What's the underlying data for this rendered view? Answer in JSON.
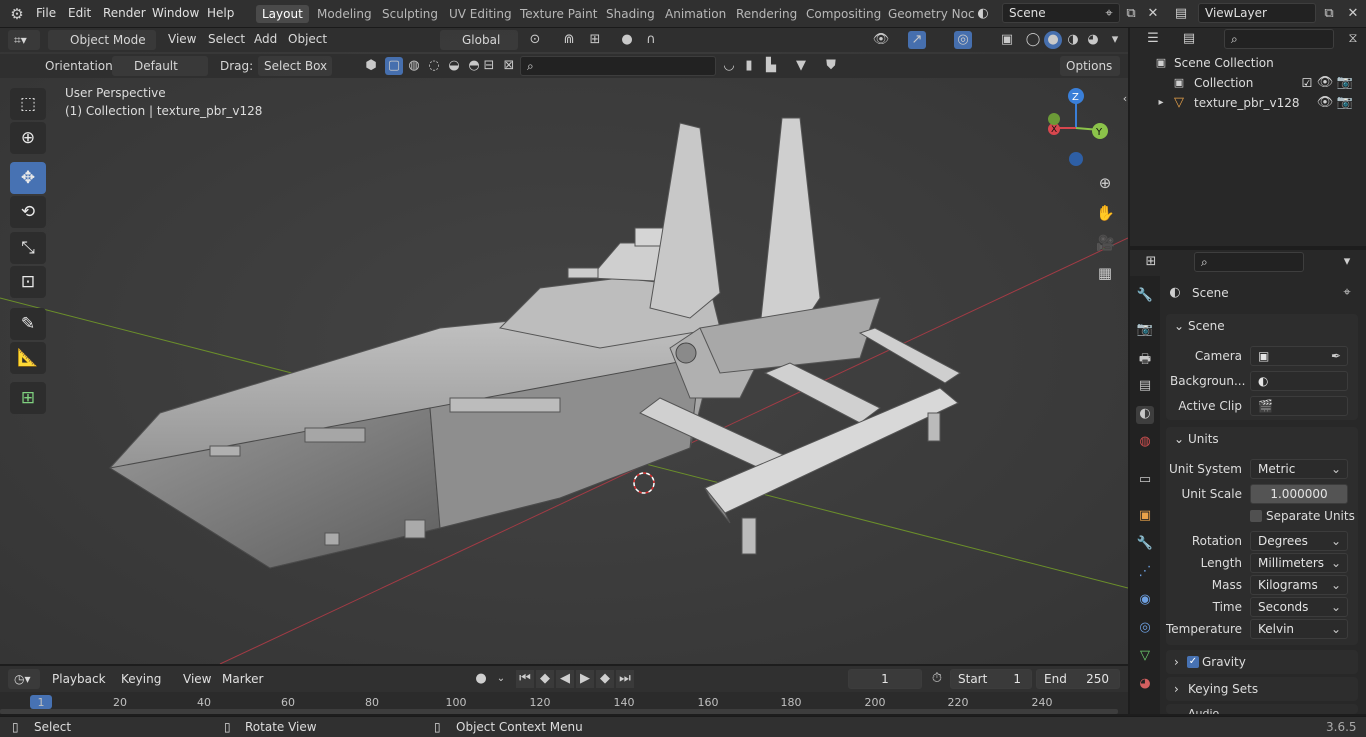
{
  "top_menu": {
    "items": [
      "File",
      "Edit",
      "Render",
      "Window",
      "Help"
    ],
    "workspaces": [
      "Layout",
      "Modeling",
      "Sculpting",
      "UV Editing",
      "Texture Paint",
      "Shading",
      "Animation",
      "Rendering",
      "Compositing",
      "Geometry Noc"
    ],
    "active_workspace": "Layout",
    "scene": "Scene",
    "view_layer": "ViewLayer"
  },
  "viewport_header": {
    "mode": "Object Mode",
    "menus": [
      "View",
      "Select",
      "Add",
      "Object"
    ],
    "transform_orientation": "Global"
  },
  "tool_settings": {
    "orientation_label": "Orientation:",
    "orientation_value": "Default",
    "drag_label": "Drag:",
    "drag_value": "Select Box",
    "options_label": "Options"
  },
  "viewport": {
    "perspective_label": "User Perspective",
    "collection_label": "(1) Collection | texture_pbr_v128",
    "gizmo_axes": [
      "Z",
      "Y",
      "X"
    ]
  },
  "toolbar_tools": [
    "select-box",
    "cursor",
    "move",
    "rotate",
    "scale",
    "transform",
    "annotate",
    "measure",
    "add-cube"
  ],
  "outliner": {
    "root": "Scene Collection",
    "items": [
      {
        "label": "Collection",
        "type": "collection"
      },
      {
        "label": "texture_pbr_v128",
        "type": "object"
      }
    ]
  },
  "properties": {
    "context_title": "Scene",
    "scene_section": {
      "title": "Scene",
      "fields": [
        {
          "label": "Camera",
          "value": ""
        },
        {
          "label": "Backgroun...",
          "value": ""
        },
        {
          "label": "Active Clip",
          "value": ""
        }
      ]
    },
    "units_section": {
      "title": "Units",
      "unit_system_label": "Unit System",
      "unit_system": "Metric",
      "unit_scale_label": "Unit Scale",
      "unit_scale": "1.000000",
      "separate_units_label": "Separate Units",
      "separate_units_checked": false,
      "rows": [
        {
          "label": "Rotation",
          "value": "Degrees"
        },
        {
          "label": "Length",
          "value": "Millimeters"
        },
        {
          "label": "Mass",
          "value": "Kilograms"
        },
        {
          "label": "Time",
          "value": "Seconds"
        },
        {
          "label": "Temperature",
          "value": "Kelvin"
        }
      ]
    },
    "collapsed_sections": [
      {
        "title": "Gravity",
        "checked": true
      },
      {
        "title": "Keying Sets"
      },
      {
        "title": "Audio"
      }
    ]
  },
  "timeline": {
    "menus": [
      "Playback",
      "Keying",
      "View",
      "Marker"
    ],
    "current_frame": "1",
    "start_label": "Start",
    "start": "1",
    "end_label": "End",
    "end": "250",
    "ticks": [
      "1",
      "20",
      "40",
      "60",
      "80",
      "100",
      "120",
      "140",
      "160",
      "180",
      "200",
      "220",
      "240"
    ]
  },
  "statusbar": {
    "items": [
      "Select",
      "Rotate View",
      "Object Context Menu"
    ],
    "version": "3.6.5"
  },
  "colors": {
    "accent": "#4772b3",
    "axis_x": "#d8474e",
    "axis_y": "#8bc34a",
    "axis_z": "#3a7fd8"
  }
}
